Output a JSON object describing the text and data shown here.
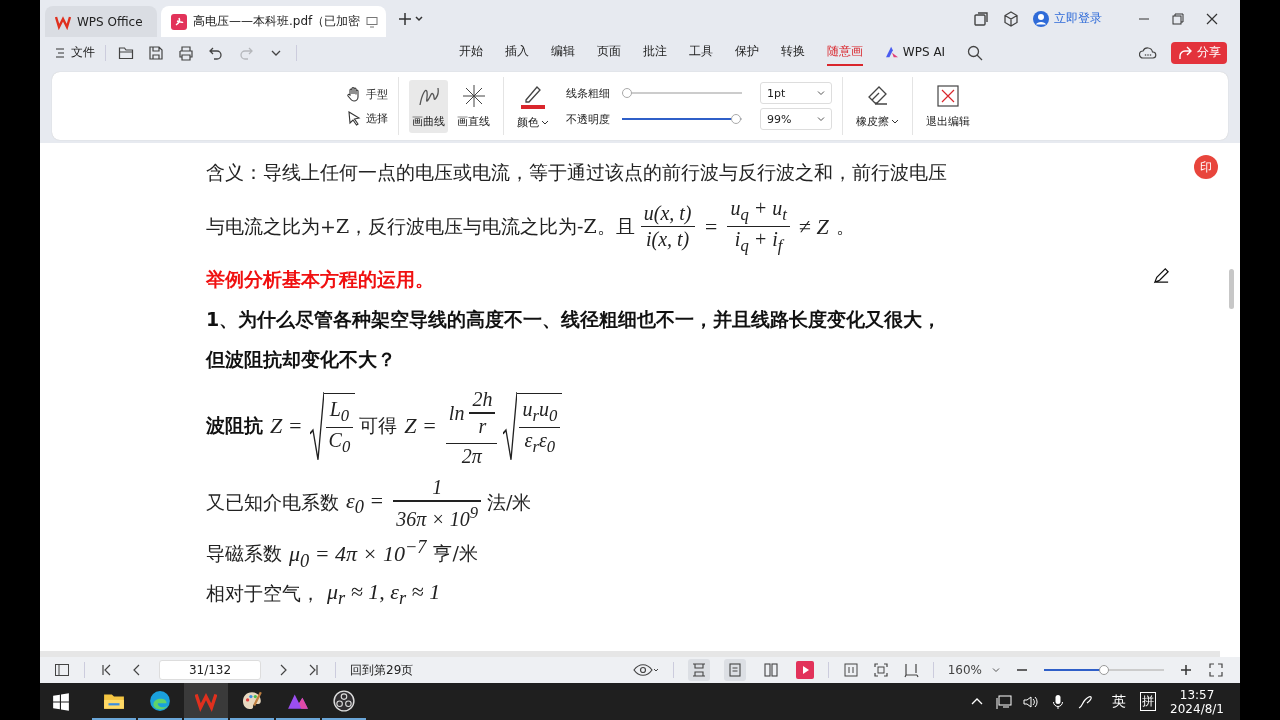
{
  "window": {
    "tabs": [
      {
        "kind": "home",
        "label": "WPS Office",
        "selected": false
      },
      {
        "kind": "pdf",
        "label": "高电压——本科班.pdf（已加密",
        "selected": true
      }
    ]
  },
  "account": {
    "label": "立即登录"
  },
  "menu": {
    "file_label": "文件",
    "redo_disabled": true,
    "tabs": [
      {
        "kind": "plain",
        "label": "开始",
        "selected": false
      },
      {
        "kind": "plain",
        "label": "插入",
        "selected": false
      },
      {
        "kind": "plain",
        "label": "编辑",
        "selected": false
      },
      {
        "kind": "plain",
        "label": "页面",
        "selected": false
      },
      {
        "kind": "plain",
        "label": "批注",
        "selected": false
      },
      {
        "kind": "plain",
        "label": "工具",
        "selected": false
      },
      {
        "kind": "plain",
        "label": "保护",
        "selected": false
      },
      {
        "kind": "plain",
        "label": "转换",
        "selected": false
      },
      {
        "kind": "plain",
        "label": "随意画",
        "selected": true
      },
      {
        "kind": "ai",
        "label": "WPS AI",
        "selected": false
      }
    ],
    "share_label": "分享"
  },
  "toolbar": {
    "hand_label": "手型",
    "select_label": "选择",
    "draw_tools": [
      {
        "kind": "curve",
        "label": "画曲线",
        "selected": true
      },
      {
        "kind": "line",
        "label": "画直线",
        "selected": false
      }
    ],
    "color_label": "颜色",
    "color": "#d9262c",
    "thickness": {
      "label": "线条粗细",
      "level": 0.0,
      "value": "1pt"
    },
    "opacity": {
      "label": "不透明度",
      "level": 0.99,
      "value": "99%"
    },
    "eraser_label": "橡皮擦",
    "exit_label": "退出编辑"
  },
  "document": {
    "badge": "印",
    "lines": [
      {
        "parts": [
          {
            "kind": "text",
            "text": "含义：导线上任何一点的电压或电流，等于通过该点的前行波与反行波之和，前行波电压"
          }
        ]
      },
      {
        "parts": [
          {
            "kind": "text",
            "text": "与电流之比为+Z，反行波电压与电流之比为-Z。且"
          },
          {
            "kind": "frac",
            "num": [
              {
                "kind": "math",
                "text": "u(x, t)"
              }
            ],
            "den": [
              {
                "kind": "math",
                "text": "i(x, t)"
              }
            ]
          },
          {
            "kind": "math",
            "text": "="
          },
          {
            "kind": "frac",
            "num": [
              {
                "kind": "math",
                "text": "u$_{q}$ + u$_{t}$"
              }
            ],
            "den": [
              {
                "kind": "math",
                "text": "i$_{q}$ + i$_{f}$"
              }
            ]
          },
          {
            "kind": "math",
            "text": "≠ Z"
          },
          {
            "kind": "text",
            "text": "。"
          }
        ]
      },
      {
        "parts": [
          {
            "kind": "alert",
            "text": "举例分析基本方程的运用。"
          }
        ]
      },
      {
        "parts": [
          {
            "kind": "strong",
            "text": "1、为什么尽管各种架空导线的高度不一、线径粗细也不一，并且线路长度变化又很大，"
          }
        ]
      },
      {
        "parts": [
          {
            "kind": "strong",
            "text": "但波阻抗却变化不大？"
          }
        ]
      },
      {
        "parts": [
          {
            "kind": "strong",
            "text": "波阻抗"
          },
          {
            "kind": "math",
            "text": "Z ="
          },
          {
            "kind": "sqrt",
            "body": [
              {
                "kind": "frac",
                "num": [
                  {
                    "kind": "math",
                    "text": "L$_{0}$"
                  }
                ],
                "den": [
                  {
                    "kind": "math",
                    "text": "C$_{0}$"
                  }
                ]
              }
            ]
          },
          {
            "kind": "text",
            "text": "可得"
          },
          {
            "kind": "math",
            "text": "Z ="
          },
          {
            "kind": "frac",
            "num": [
              {
                "kind": "math",
                "text": "ln"
              },
              {
                "kind": "frac",
                "num": [
                  {
                    "kind": "math",
                    "text": "2h"
                  }
                ],
                "den": [
                  {
                    "kind": "math",
                    "text": "r"
                  }
                ]
              }
            ],
            "den": [
              {
                "kind": "math",
                "text": "2π"
              }
            ]
          },
          {
            "kind": "sqrt",
            "body": [
              {
                "kind": "frac",
                "num": [
                  {
                    "kind": "math",
                    "text": "u$_{r}$u$_{0}$"
                  }
                ],
                "den": [
                  {
                    "kind": "math",
                    "text": "ε$_{r}$ε$_{0}$"
                  }
                ]
              }
            ]
          }
        ]
      },
      {
        "parts": [
          {
            "kind": "text",
            "text": "又已知介电系数"
          },
          {
            "kind": "math",
            "text": "ε$_{0}$ ="
          },
          {
            "kind": "frac",
            "num": [
              {
                "kind": "math",
                "text": "1"
              }
            ],
            "den": [
              {
                "kind": "math",
                "text": "36π × 10$^{9}$"
              }
            ]
          },
          {
            "kind": "text",
            "text": "法/米"
          }
        ]
      },
      {
        "parts": [
          {
            "kind": "text",
            "text": "导磁系数"
          },
          {
            "kind": "math",
            "text": "μ$_{0}$ = 4π × 10$^{−7}$"
          },
          {
            "kind": "text",
            "text": "亨/米"
          }
        ]
      },
      {
        "parts": [
          {
            "kind": "text",
            "text": "相对于空气，"
          },
          {
            "kind": "math",
            "text": "μ$_{r}$ ≈ 1, ε$_{r}$ ≈ 1"
          }
        ]
      }
    ]
  },
  "status_bar": {
    "page": "31/132",
    "back_link": "回到第29页",
    "view_modes": [
      {
        "kind": "continuous",
        "selected": true
      },
      {
        "kind": "single",
        "selected": true
      },
      {
        "kind": "double",
        "selected": false
      }
    ],
    "zoom": {
      "value": "160%",
      "level": 0.5
    }
  },
  "taskbar": {
    "apps": [
      {
        "kind": "explorer",
        "active": false
      },
      {
        "kind": "edge",
        "active": false
      },
      {
        "kind": "wps",
        "active": true
      },
      {
        "kind": "paint",
        "active": false
      },
      {
        "kind": "studio",
        "active": false
      },
      {
        "kind": "obs",
        "active": false
      }
    ],
    "ime": "英",
    "ime_mode": "拼",
    "time": "13:57",
    "date": "2024/8/1"
  }
}
